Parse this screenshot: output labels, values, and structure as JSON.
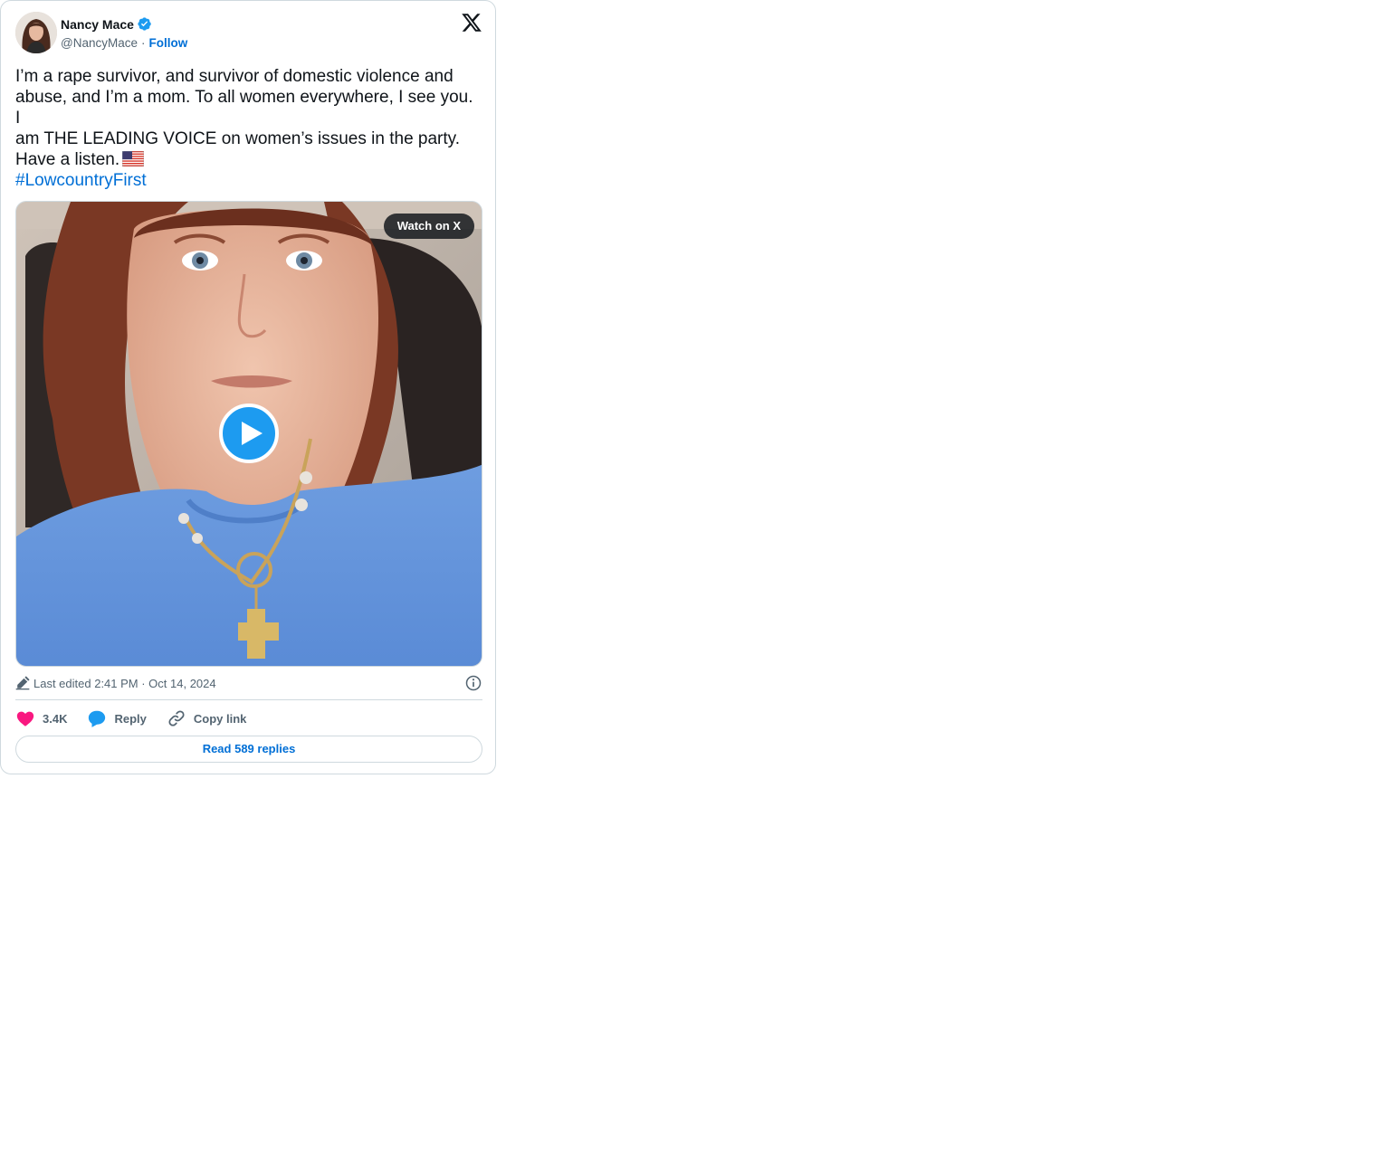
{
  "author": {
    "name": "Nancy Mace",
    "handle": "@NancyMace",
    "separator": "·",
    "follow_label": "Follow",
    "verified": true
  },
  "tweet": {
    "lines": [
      "I’m a rape survivor, and survivor of domestic violence and",
      "abuse, and I’m a mom. To all women everywhere, I see you. I",
      "am THE LEADING VOICE on women’s issues in the party.",
      "Have a listen."
    ],
    "emoji": "flag-us-icon",
    "hashtag": "#LowcountryFirst"
  },
  "media": {
    "watch_label": "Watch on X",
    "type": "video"
  },
  "meta": {
    "edited": "Last edited 2:41 PM · Oct 14, 2024"
  },
  "actions": {
    "likes": "3.4K",
    "reply_label": "Reply",
    "copy_label": "Copy link"
  },
  "footer": {
    "read_replies": "Read 589 replies"
  },
  "colors": {
    "link": "#006fd6",
    "like": "#f91880",
    "reply": "#1d9bf0",
    "border": "#cfd9de",
    "muted": "#536471"
  }
}
